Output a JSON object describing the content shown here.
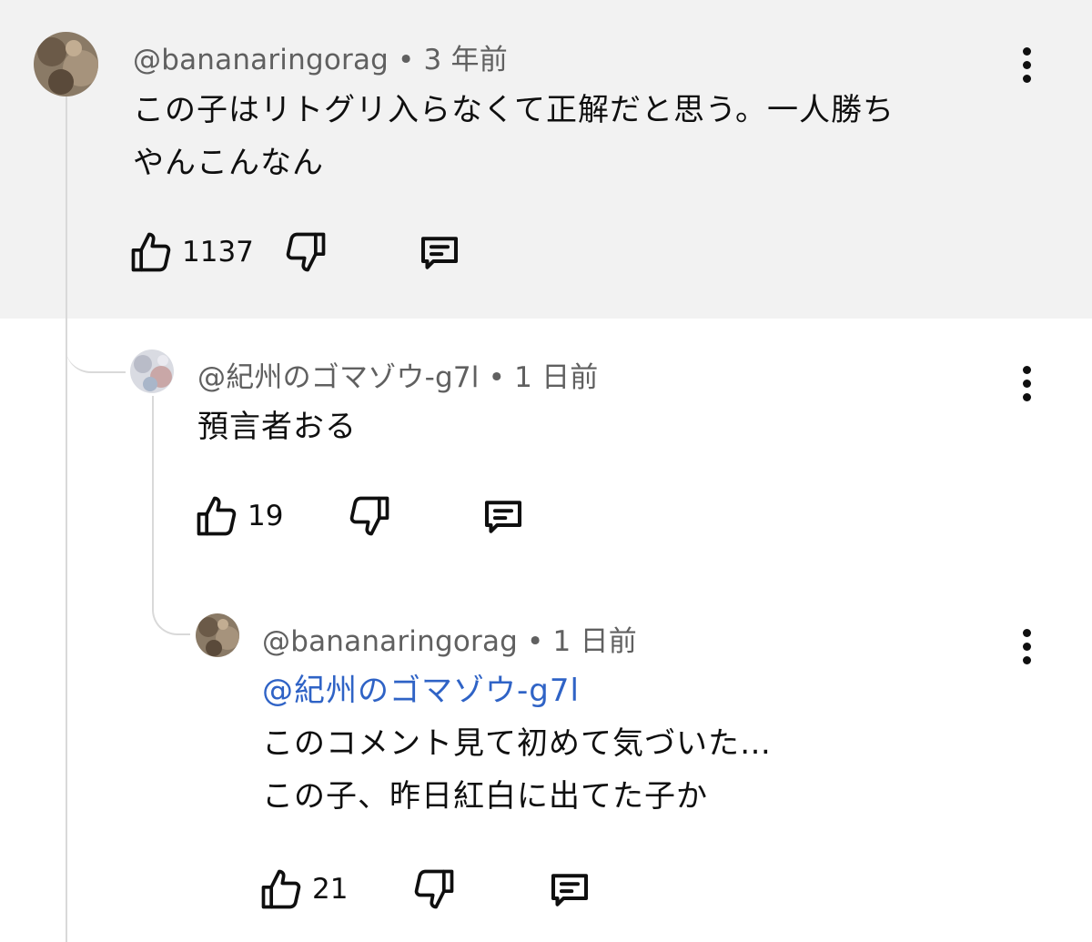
{
  "comments": [
    {
      "author": "@bananaringorag",
      "time": "3 年前",
      "lines": [
        "この子はリトグリ入らなくて正解だと思う。一人勝ち",
        "やんこんなん"
      ],
      "likes": "1137"
    },
    {
      "author": "@紀州のゴマゾウ-g7l",
      "time": "1 日前",
      "lines": [
        "預言者おる"
      ],
      "likes": "19"
    },
    {
      "author": "@bananaringorag",
      "time": "1 日前",
      "mention": "@紀州のゴマゾウ-g7l",
      "lines": [
        "このコメント見て初めて気づいた…",
        "この子、昨日紅白に出てた子か"
      ],
      "likes": "21"
    }
  ],
  "meta_separator": "•",
  "colors": {
    "highlight_bg": "#f2f2f2",
    "mention": "#2f63c6",
    "secondary_text": "#606060",
    "thread_line": "#d9d9d9"
  },
  "icons": [
    "like-icon",
    "dislike-icon",
    "reply-icon",
    "more-options-icon"
  ]
}
